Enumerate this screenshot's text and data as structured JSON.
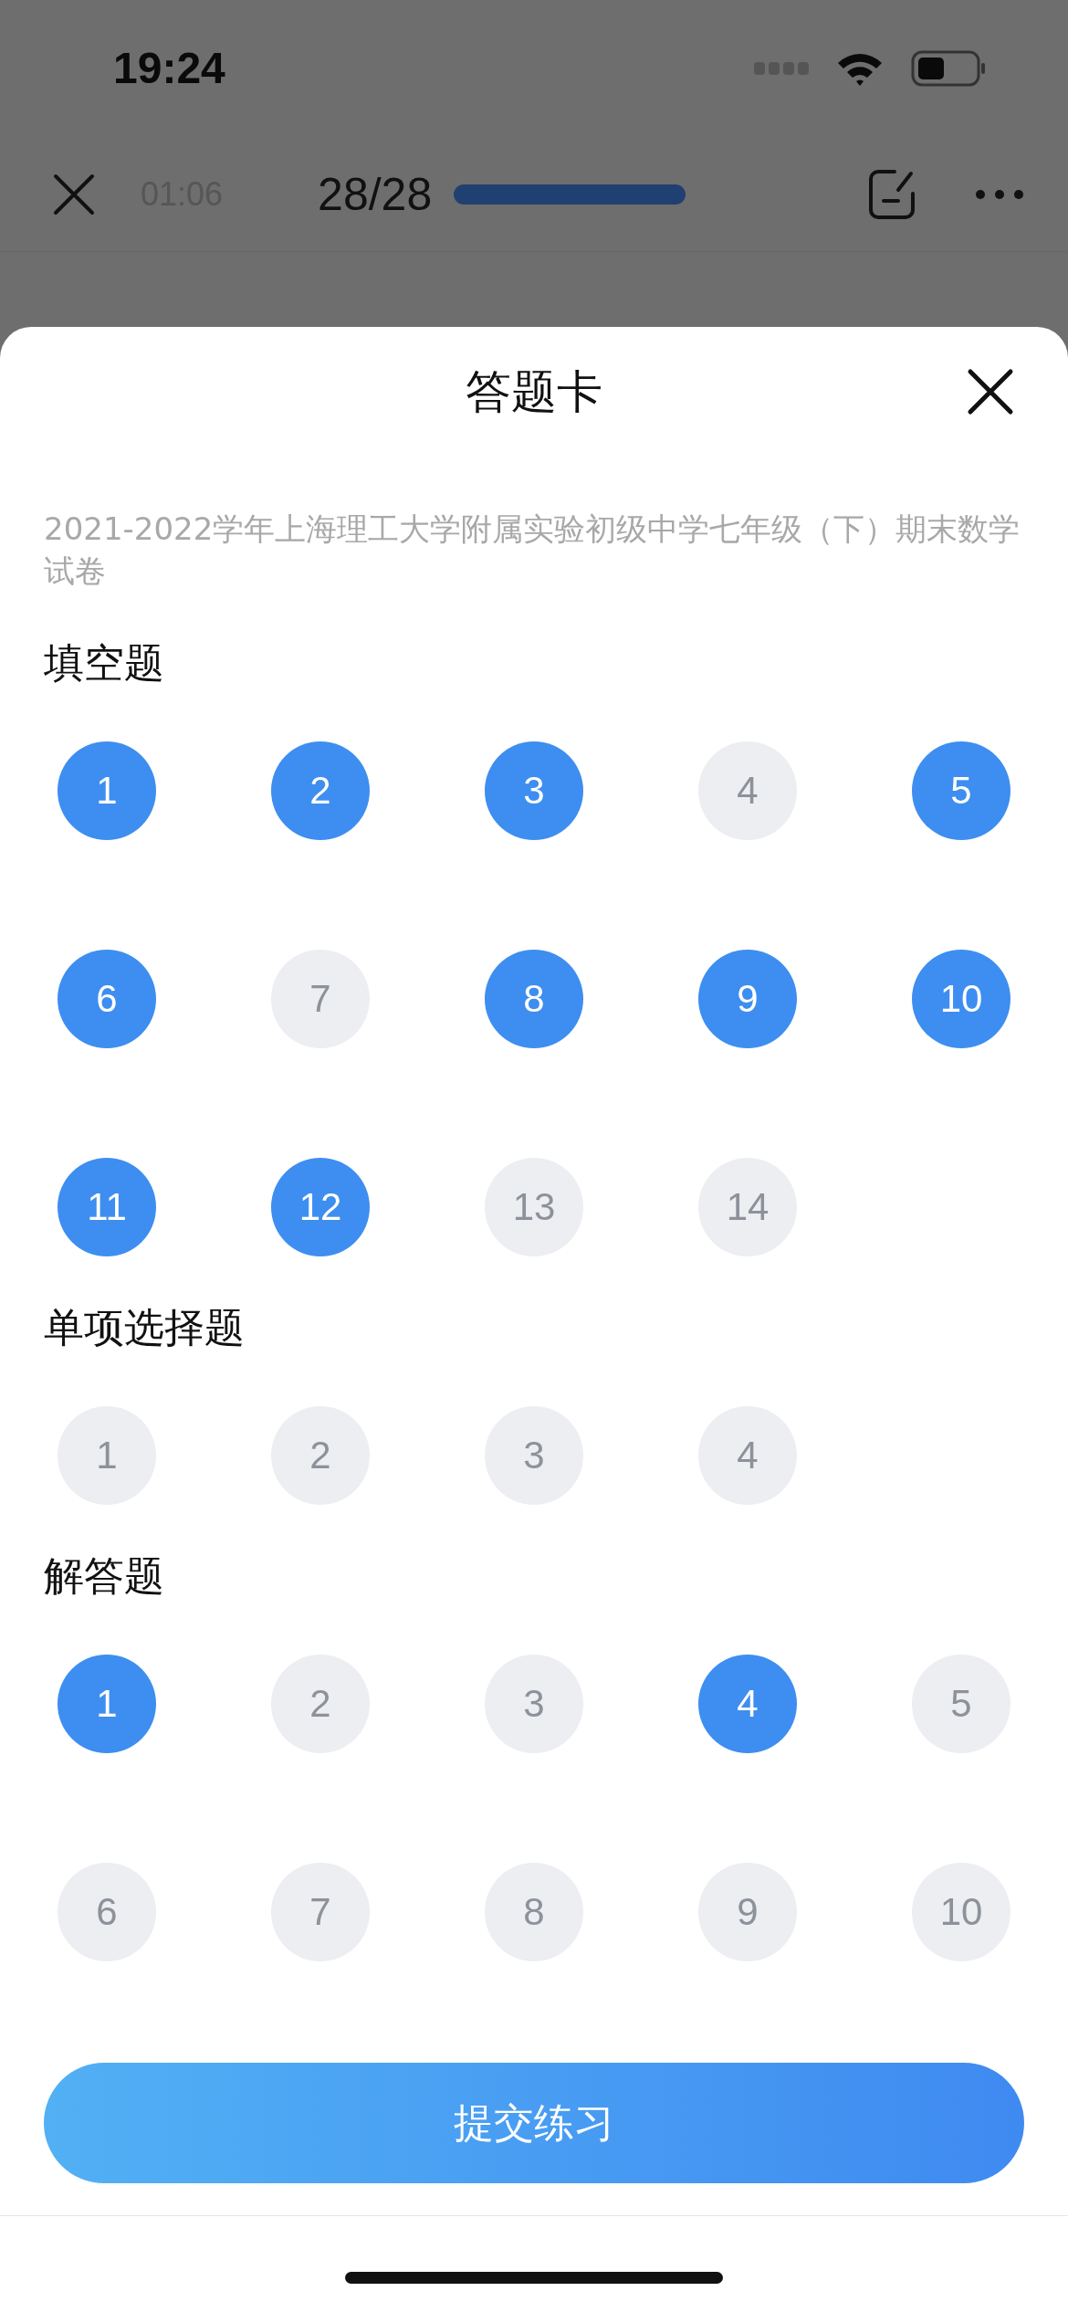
{
  "status_bar": {
    "time": "19:24"
  },
  "nav_bar": {
    "timer": "01:06",
    "progress_text": "28/28",
    "progress": {
      "level": 1
    }
  },
  "answer_sheet": {
    "title": "答题卡",
    "paper_title": "2021-2022学年上海理工大学附属实验初级中学七年级（下）期末数学试卷",
    "sections": [
      {
        "heading": "填空题",
        "questions": [
          {
            "number": "1",
            "answered": true
          },
          {
            "number": "2",
            "answered": true
          },
          {
            "number": "3",
            "answered": true
          },
          {
            "number": "4",
            "answered": false
          },
          {
            "number": "5",
            "answered": true
          },
          {
            "number": "6",
            "answered": true
          },
          {
            "number": "7",
            "answered": false
          },
          {
            "number": "8",
            "answered": true
          },
          {
            "number": "9",
            "answered": true
          },
          {
            "number": "10",
            "answered": true
          },
          {
            "number": "11",
            "answered": true
          },
          {
            "number": "12",
            "answered": true
          },
          {
            "number": "13",
            "answered": false
          },
          {
            "number": "14",
            "answered": false
          }
        ]
      },
      {
        "heading": "单项选择题",
        "questions": [
          {
            "number": "1",
            "answered": false
          },
          {
            "number": "2",
            "answered": false
          },
          {
            "number": "3",
            "answered": false
          },
          {
            "number": "4",
            "answered": false
          }
        ]
      },
      {
        "heading": "解答题",
        "questions": [
          {
            "number": "1",
            "answered": true
          },
          {
            "number": "2",
            "answered": false
          },
          {
            "number": "3",
            "answered": false
          },
          {
            "number": "4",
            "answered": true
          },
          {
            "number": "5",
            "answered": false
          },
          {
            "number": "6",
            "answered": false
          },
          {
            "number": "7",
            "answered": false
          },
          {
            "number": "8",
            "answered": false
          },
          {
            "number": "9",
            "answered": false
          },
          {
            "number": "10",
            "answered": false
          }
        ]
      }
    ],
    "submit_button": "提交练习"
  }
}
